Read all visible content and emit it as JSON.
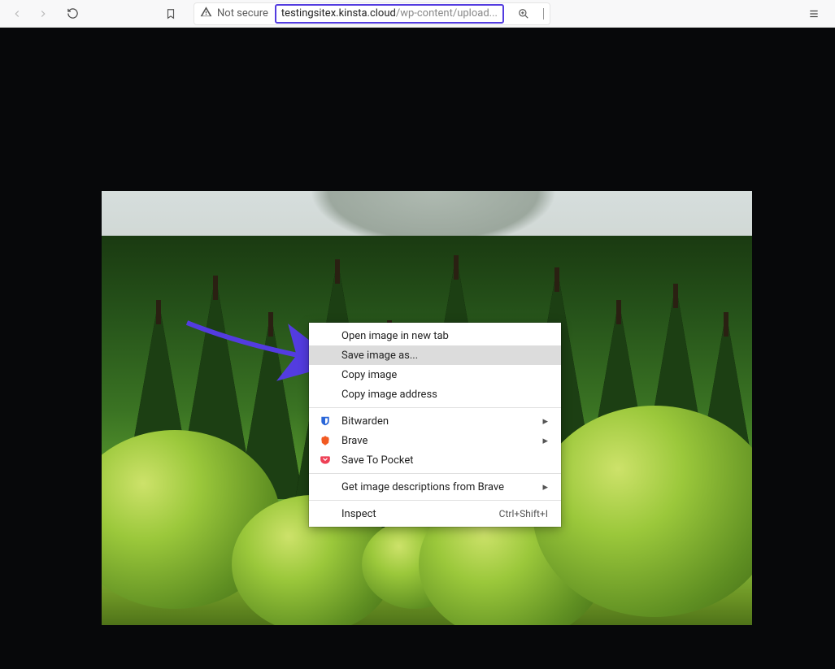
{
  "toolbar": {
    "not_secure_label": "Not secure",
    "url_domain": "testingsitex.kinsta.cloud",
    "url_path": "/wp-content/upload..."
  },
  "annotation": {
    "arrow_color": "#533ce0"
  },
  "context_menu": {
    "items": [
      {
        "label": "Open image in new tab"
      },
      {
        "label": "Save image as...",
        "highlight": true
      },
      {
        "label": "Copy image"
      },
      {
        "label": "Copy image address"
      }
    ],
    "ext_items": [
      {
        "label": "Bitwarden",
        "icon": "bitwarden",
        "submenu": true
      },
      {
        "label": "Brave",
        "icon": "brave",
        "submenu": true
      },
      {
        "label": "Save To Pocket",
        "icon": "pocket"
      }
    ],
    "brave_item": {
      "label": "Get image descriptions from Brave",
      "submenu": true
    },
    "inspect": {
      "label": "Inspect",
      "shortcut": "Ctrl+Shift+I"
    }
  }
}
